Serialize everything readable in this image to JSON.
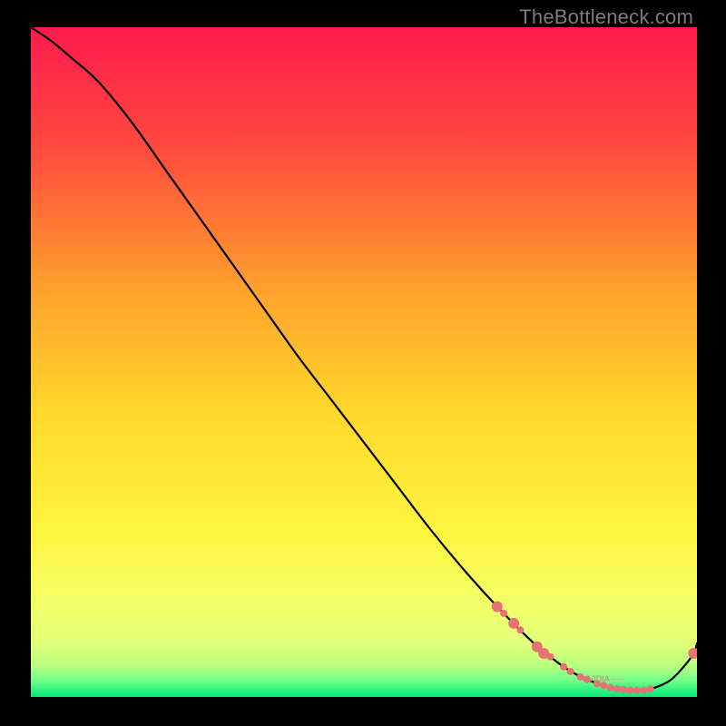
{
  "watermark": "TheBottleneck.com",
  "chart_data": {
    "type": "line",
    "title": "",
    "xlabel": "",
    "ylabel": "",
    "xlim": [
      0,
      100
    ],
    "ylim": [
      0,
      100
    ],
    "grid": false,
    "legend": false,
    "axes_visible": false,
    "background_gradient": {
      "top": "#ff1a4d",
      "upper_mid": "#ff7a2e",
      "mid": "#ffd22c",
      "lower_mid": "#f6ff62",
      "low": "#dfff7a",
      "lowest": "#00e878"
    },
    "series": [
      {
        "name": "bottleneck-curve",
        "color": "#000000",
        "x": [
          0,
          3,
          6,
          10,
          15,
          20,
          25,
          30,
          35,
          40,
          45,
          50,
          55,
          60,
          65,
          70,
          75,
          78,
          80,
          82,
          84,
          86,
          88,
          90,
          92,
          94,
          96,
          98,
          99.5,
          100
        ],
        "y": [
          100,
          98,
          95.5,
          92,
          86,
          79,
          72,
          65,
          58,
          51,
          44.5,
          38,
          31.5,
          25,
          19,
          13.5,
          8.5,
          6,
          4.5,
          3.3,
          2.4,
          1.7,
          1.2,
          1,
          1,
          1.5,
          2.5,
          4.5,
          6.5,
          8
        ]
      }
    ],
    "scatter_points": {
      "name": "highlighted-points",
      "color": "#e57373",
      "radius_small": 4,
      "radius_large": 6,
      "points": [
        {
          "x": 70,
          "y": 13.5,
          "r": "large"
        },
        {
          "x": 71,
          "y": 12.5,
          "r": "small"
        },
        {
          "x": 72.5,
          "y": 11,
          "r": "large"
        },
        {
          "x": 73.5,
          "y": 10,
          "r": "small"
        },
        {
          "x": 76,
          "y": 7.5,
          "r": "large"
        },
        {
          "x": 77,
          "y": 6.5,
          "r": "large"
        },
        {
          "x": 78,
          "y": 6,
          "r": "small"
        },
        {
          "x": 80,
          "y": 4.5,
          "r": "small"
        },
        {
          "x": 81,
          "y": 3.8,
          "r": "small"
        },
        {
          "x": 82.5,
          "y": 3,
          "r": "small"
        },
        {
          "x": 83.5,
          "y": 2.6,
          "r": "small"
        },
        {
          "x": 85,
          "y": 2,
          "r": "small"
        },
        {
          "x": 86,
          "y": 1.7,
          "r": "small"
        },
        {
          "x": 87,
          "y": 1.4,
          "r": "small"
        },
        {
          "x": 88,
          "y": 1.2,
          "r": "small"
        },
        {
          "x": 89,
          "y": 1.1,
          "r": "small"
        },
        {
          "x": 90,
          "y": 1,
          "r": "small"
        },
        {
          "x": 91,
          "y": 1,
          "r": "small"
        },
        {
          "x": 92,
          "y": 1,
          "r": "small"
        },
        {
          "x": 93,
          "y": 1.2,
          "r": "small"
        },
        {
          "x": 99.5,
          "y": 6.5,
          "r": "large"
        }
      ]
    },
    "label_on_curve": {
      "text_approx": "NVIDIA ·····",
      "x": 86,
      "y": 2.3
    }
  }
}
